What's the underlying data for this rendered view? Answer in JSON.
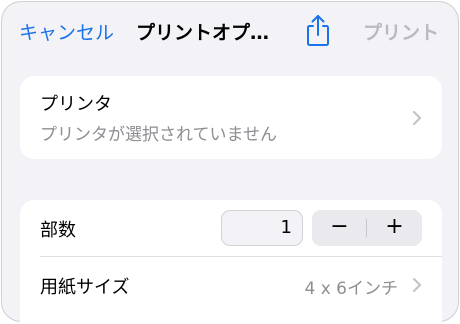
{
  "navbar": {
    "cancel_label": "キャンセル",
    "title": "プリントオプ…",
    "share_icon": "share-icon",
    "print_label": "プリント"
  },
  "printer": {
    "label": "プリンタ",
    "status": "プリンタが選択されていません",
    "chevron_icon": "chevron-right-icon"
  },
  "options": {
    "copies_label": "部数",
    "copies_value": "1",
    "minus_label": "−",
    "plus_label": "+",
    "paper_label": "用紙サイズ",
    "paper_value": "4 x 6インチ",
    "chevron_icon": "chevron-right-icon"
  },
  "colors": {
    "accent": "#1a73e8",
    "disabled": "#b9b9bf",
    "secondary_text": "#8e8e93",
    "background": "#f2f2f7",
    "card": "#ffffff"
  }
}
